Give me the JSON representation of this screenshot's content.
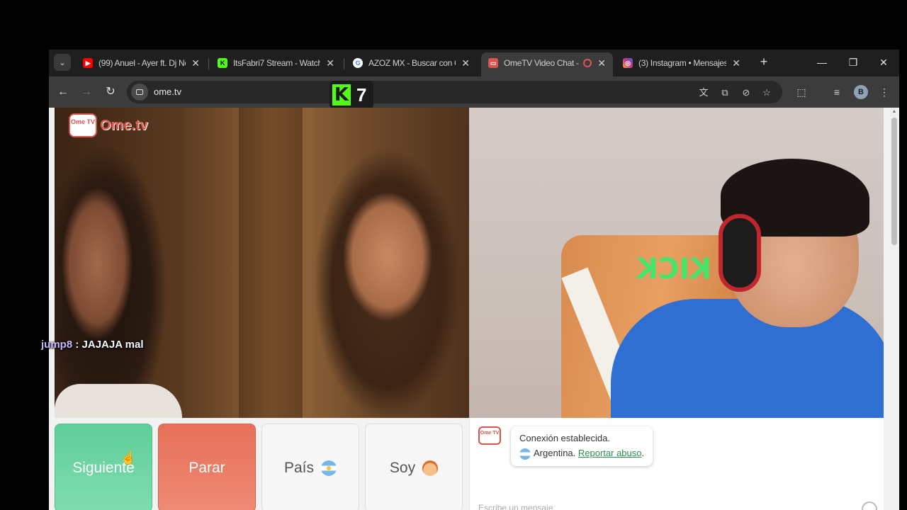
{
  "tabs": [
    {
      "title": "(99) Anuel - Ayer ft. Dj Ne",
      "favicon": "youtube-icon",
      "color": "#ff0000"
    },
    {
      "title": "ItsFabri7 Stream - Watch",
      "favicon": "kick-icon",
      "color": "#53fc18"
    },
    {
      "title": "AZOZ MX - Buscar con G",
      "favicon": "google-icon",
      "color": "#4285f4"
    },
    {
      "title": "OmeTV Video Chat -",
      "favicon": "ometv-icon",
      "color": "#d9534f",
      "active": true
    },
    {
      "title": "(3) Instagram • Mensajes",
      "favicon": "instagram-icon",
      "color": "#c13584"
    }
  ],
  "toolbar": {
    "url": "ome.tv",
    "profile_initial": "B"
  },
  "overlay": {
    "kick_count": "7",
    "chat_user": "jump8",
    "chat_message": " : JAJAJA mal"
  },
  "site": {
    "logo_icon_text": "Ome TV",
    "logo_text": "Ome.tv",
    "kick_chair_text": "KICK"
  },
  "controls": {
    "next_label": "Siguiente",
    "stop_label": "Parar",
    "country_label": "País",
    "gender_label": "Soy"
  },
  "chat": {
    "status": "Conexión establecida.",
    "country": "Argentina.",
    "report_link": "Reportar abuso",
    "report_suffix": ".",
    "input_placeholder": "Escribe un mensaje"
  },
  "colors": {
    "next": "#6fd6a2",
    "stop": "#ea7c66",
    "kick_green": "#53fc18"
  }
}
